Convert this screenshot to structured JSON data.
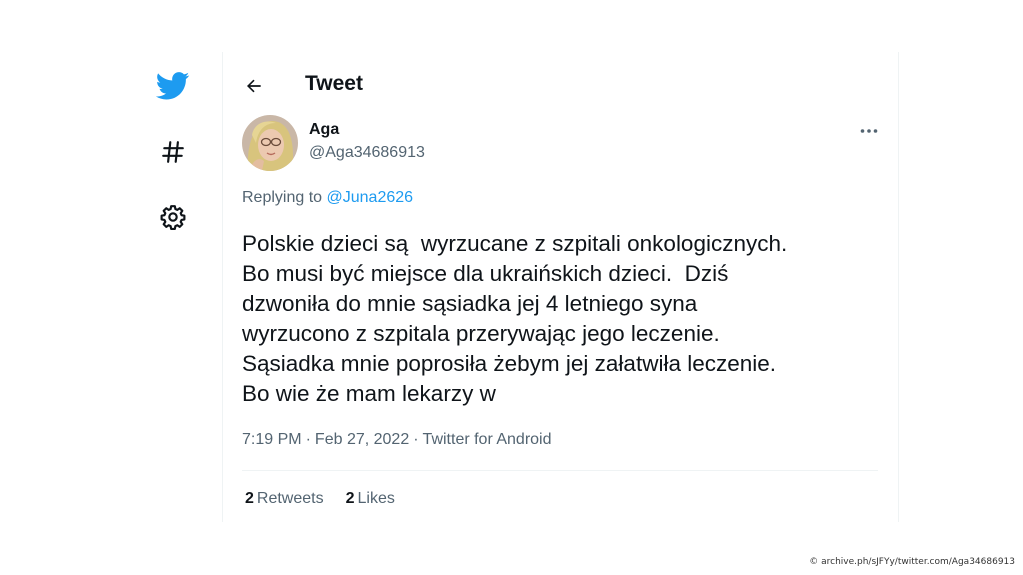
{
  "colors": {
    "brand": "#1d9bf0",
    "text": "#0f1419",
    "muted": "#536471"
  },
  "sidebar": {
    "icons": [
      "twitter-bird-icon",
      "hashtag-icon",
      "settings-gear-icon"
    ]
  },
  "header": {
    "title": "Tweet",
    "back_icon": "arrow-left-icon"
  },
  "tweet": {
    "author_name": "Aga",
    "author_handle": "@Aga34686913",
    "reply_prefix": "Replying to ",
    "reply_handle": "@Juna2626",
    "more_icon": "more-horizontal-icon",
    "text": "Polskie dzieci są  wyrzucane z szpitali onkologicznych.\nBo musi być miejsce dla ukraińskich dzieci.  Dziś\ndzwoniła do mnie sąsiadka jej 4 letniego syna\nwyrzucono z szpitala przerywając jego leczenie.\nSąsiadka mnie poprosiła żebym jej załatwiła leczenie.\nBo wie że mam lekarzy w",
    "time": "7:19 PM",
    "date": "Feb 27, 2022",
    "source": "Twitter for Android",
    "separator": "·"
  },
  "stats": {
    "retweets_count": "2",
    "retweets_label": "Retweets",
    "likes_count": "2",
    "likes_label": "Likes"
  },
  "credit": "© archive.ph/sJFYy/twitter.com/Aga34686913"
}
